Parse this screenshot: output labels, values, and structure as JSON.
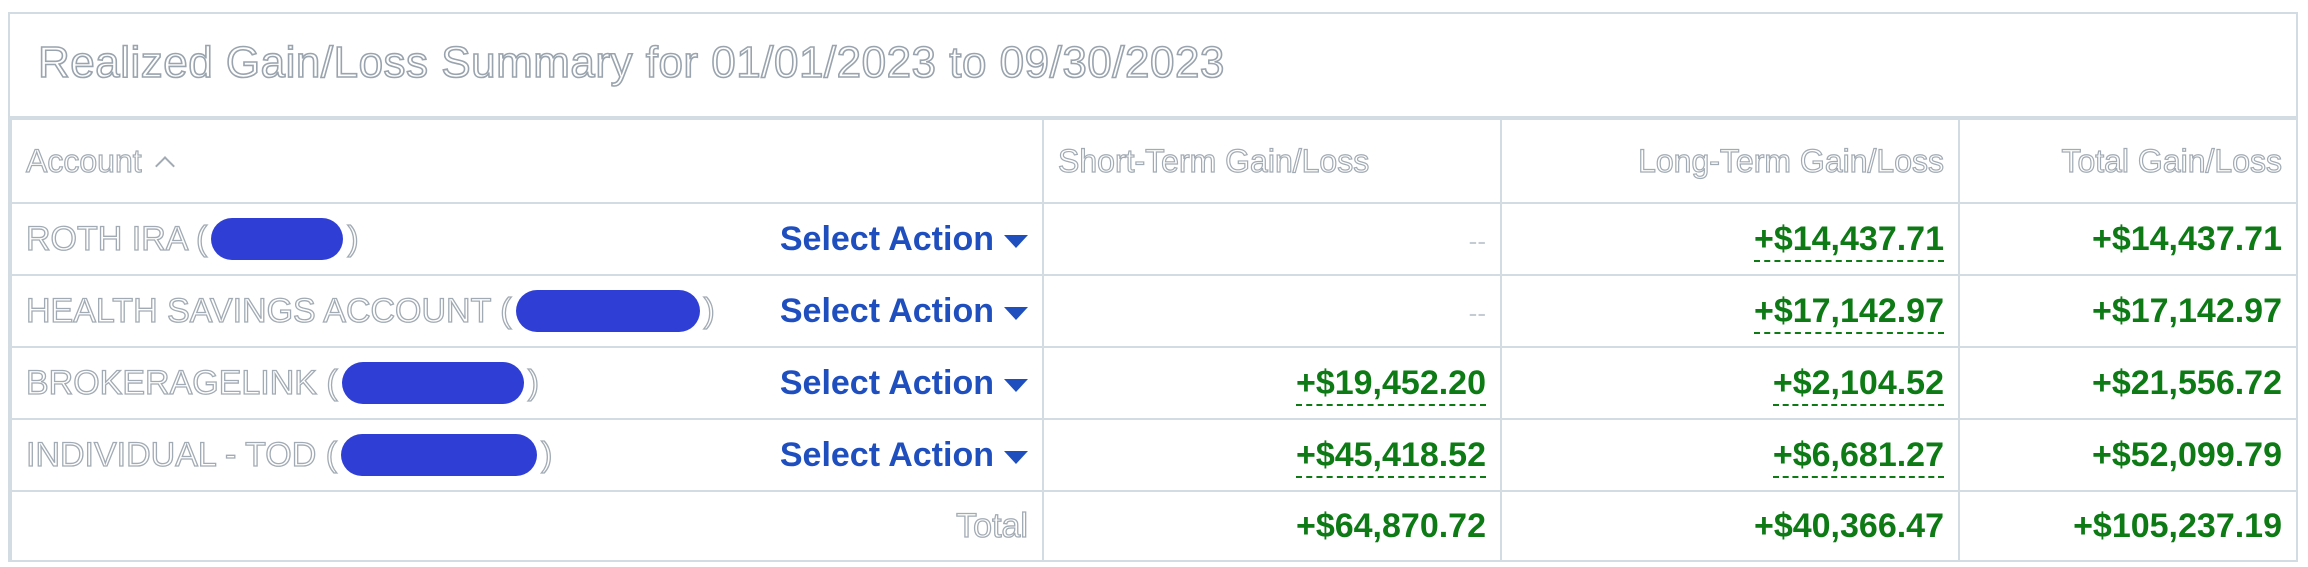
{
  "title": "Realized Gain/Loss Summary for 01/01/2023 to 09/30/2023",
  "columns": {
    "account": "Account",
    "short_term": "Short-Term Gain/Loss",
    "long_term": "Long-Term Gain/Loss",
    "total": "Total Gain/Loss"
  },
  "rows": [
    {
      "account_name": "ROTH IRA (",
      "account_close": ")",
      "action_label": "Select Action",
      "short_term": "--",
      "long_term": "+$14,437.71",
      "total": "+$14,437.71"
    },
    {
      "account_name": "HEALTH SAVINGS ACCOUNT (",
      "account_close": ")",
      "action_label": "Select Action",
      "short_term": "--",
      "long_term": "+$17,142.97",
      "total": "+$17,142.97"
    },
    {
      "account_name": "BROKERAGELINK (",
      "account_close": ")",
      "action_label": "Select Action",
      "short_term": "+$19,452.20",
      "long_term": "+$2,104.52",
      "total": "+$21,556.72"
    },
    {
      "account_name": "INDIVIDUAL - TOD (",
      "account_close": ")",
      "action_label": "Select Action",
      "short_term": "+$45,418.52",
      "long_term": "+$6,681.27",
      "total": "+$52,099.79"
    }
  ],
  "totals": {
    "label": "Total",
    "short_term": "+$64,870.72",
    "long_term": "+$40,366.47",
    "total": "+$105,237.19"
  },
  "colors": {
    "gain_green": "#0e7a16",
    "action_blue": "#1f4fbf",
    "redaction_blue": "#2f3fd6",
    "border": "#d3dbe3"
  },
  "icons": {
    "sort": "chevron-up-icon",
    "action_menu": "caret-down-icon"
  }
}
